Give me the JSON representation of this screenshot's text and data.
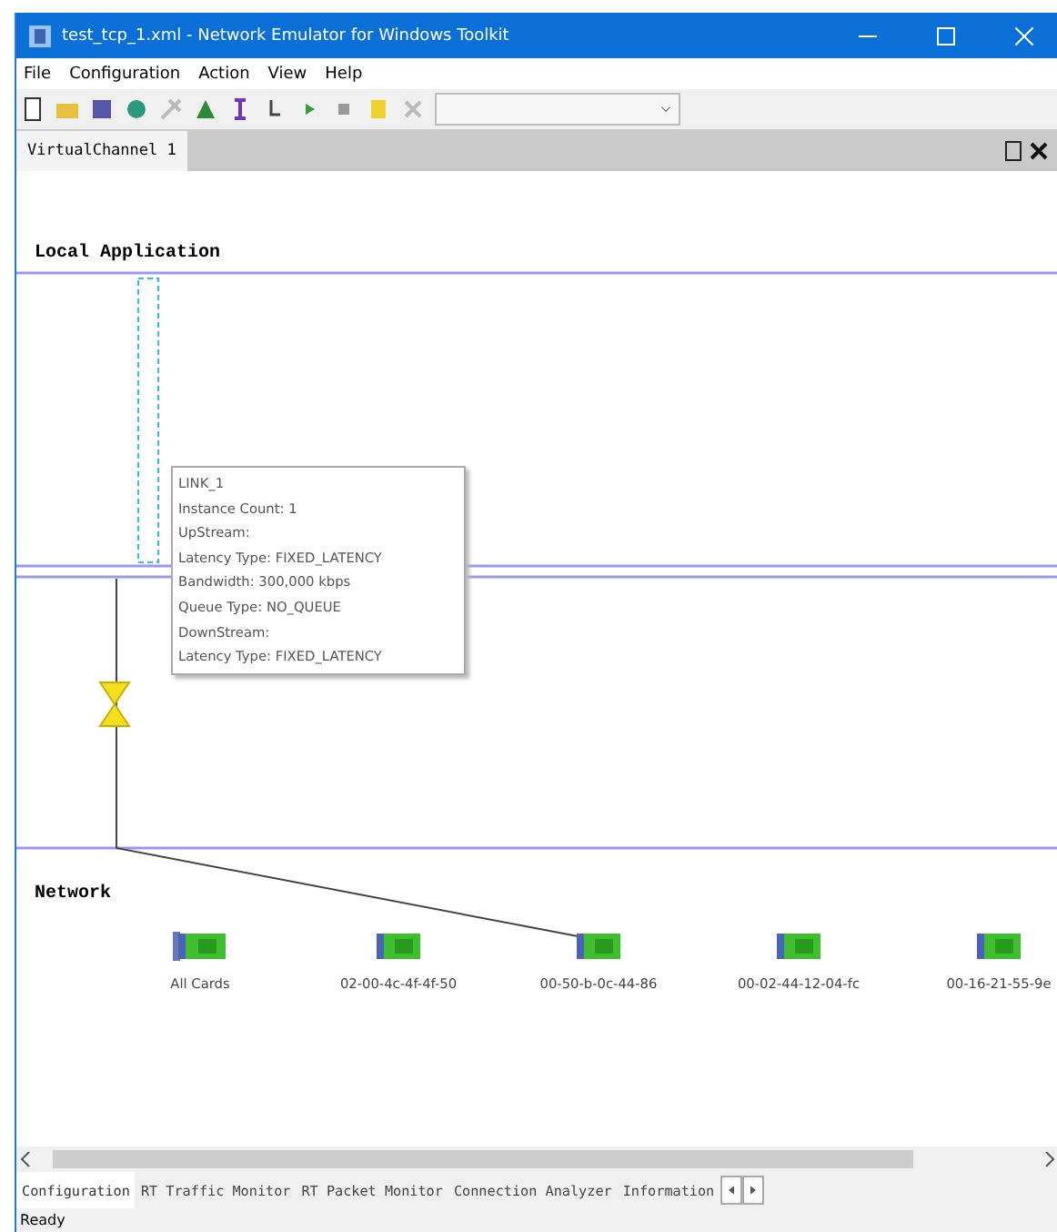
{
  "window": {
    "title": "test_tcp_1.xml - Network Emulator for Windows Toolkit"
  },
  "menu": [
    "File",
    "Configuration",
    "Action",
    "View",
    "Help"
  ],
  "document_tab": {
    "label": "VirtualChannel 1",
    "selected": true
  },
  "canvas": {
    "local_label": "Local Application",
    "network_label": "Network",
    "tooltip": [
      "LINK_1",
      "Instance Count: 1",
      "UpStream:",
      "Latency Type: FIXED_LATENCY",
      "Bandwidth: 300,000 kbps",
      "Queue Type: NO_QUEUE",
      "DownStream:",
      "Latency Type: FIXED_LATENCY"
    ],
    "nodes": [
      {
        "label": "All Cards",
        "kind": "all"
      },
      {
        "label": "02-00-4c-4f-4f-50",
        "kind": "card"
      },
      {
        "label": "00-50-b-0c-44-86",
        "kind": "card"
      },
      {
        "label": "00-02-44-12-04-fc",
        "kind": "card"
      },
      {
        "label": "00-16-21-55-9e",
        "kind": "card"
      }
    ]
  },
  "bottom_tabs": [
    {
      "label": "Configuration",
      "selected": true
    },
    {
      "label": "RT Traffic Monitor",
      "selected": false
    },
    {
      "label": "RT Packet Monitor",
      "selected": false
    },
    {
      "label": "Connection Analyzer",
      "selected": false
    },
    {
      "label": "Information",
      "selected": false
    }
  ],
  "status_bar": "Ready"
}
